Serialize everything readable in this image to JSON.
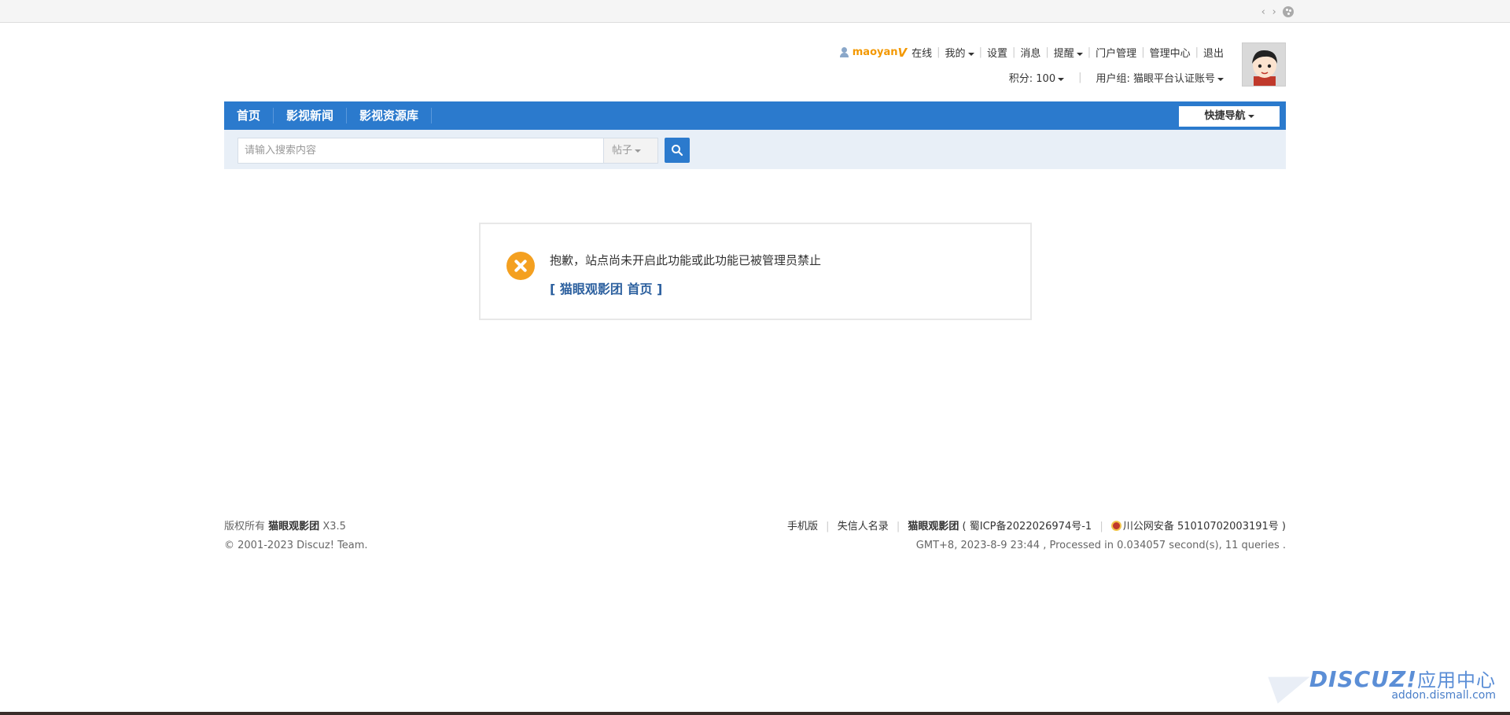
{
  "toolbar": {
    "code_icon": "code-icon",
    "palette_icon": "palette-icon"
  },
  "user": {
    "username": "maoyan",
    "verified_mark": "V",
    "links": [
      "在线",
      "我的",
      "设置",
      "消息",
      "提醒",
      "门户管理",
      "管理中心",
      "退出"
    ],
    "points": "积分: 100",
    "usergroup": "用户组: 猫眼平台认证账号"
  },
  "nav": {
    "items": [
      "首页",
      "影视新闻",
      "影视资源库"
    ],
    "quick_nav": "快捷导航"
  },
  "search": {
    "placeholder": "请输入搜索内容",
    "type": "帖子"
  },
  "alert": {
    "message": "抱歉，站点尚未开启此功能或此功能已被管理员禁止",
    "link": "[ 猫眼观影团 首页 ]"
  },
  "footer": {
    "copyright_prefix": "版权所有",
    "site_name": "猫眼观影团",
    "version": "X3.5",
    "copyright_line": "© 2001-2023 Discuz! Team.",
    "links": [
      "手机版",
      "失信人名录"
    ],
    "icp_site": "猫眼观影团",
    "icp": "( 蜀ICP备2022026974号-1",
    "police": "川公网安备 51010702003191号 )",
    "processed": "GMT+8, 2023-8-9 23:44 , Processed in 0.034057 second(s), 11 queries ."
  },
  "watermark": {
    "brand": "DISCUZ!",
    "app_center": "应用中心",
    "url": "addon.dismall.com"
  }
}
